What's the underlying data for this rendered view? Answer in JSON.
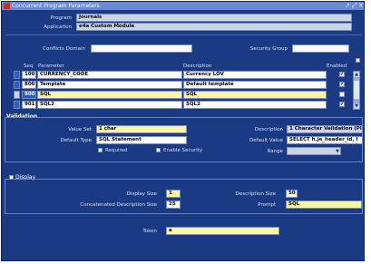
{
  "window": {
    "title": "Concurrent Program Parameters",
    "controls": [
      "↗",
      "⤢",
      "✕"
    ]
  },
  "header": {
    "program_label": "Program",
    "program_value": "Journals",
    "application_label": "Application",
    "application_value": "e4a Custom Module",
    "conflicts_label": "Conflicts Domain",
    "conflicts_value": "",
    "security_label": "Security Group",
    "security_value": ""
  },
  "grid": {
    "headers": {
      "seq": "Seq",
      "parameter": "Parameter",
      "description": "Description",
      "enabled": "Enabled"
    },
    "rows": [
      {
        "seq": "100",
        "parameter": "CURRENCY_CODE",
        "description": "Currency LOV",
        "enabled": "✔"
      },
      {
        "seq": "800",
        "parameter": "Template",
        "description": "Default template",
        "enabled": "✔"
      },
      {
        "seq": "900",
        "parameter": "SQL",
        "description": "SQL",
        "enabled": ""
      },
      {
        "seq": "901",
        "parameter": "SQL2",
        "description": "SQL2",
        "enabled": "✔"
      }
    ]
  },
  "validation": {
    "title": "Validation",
    "value_set_label": "Value Set",
    "value_set": "1 char",
    "description_label": "Description",
    "description": "1 Character Validation (Pla",
    "default_type_label": "Default Type",
    "default_type": "SQL Statement",
    "default_value_label": "Default Value",
    "default_value": "SELECT h.je_header_id, I",
    "required_label": "Required",
    "enable_security_label": "Enable Security",
    "range_label": "Range",
    "range_value": ""
  },
  "display": {
    "title": "Display",
    "display_size_label": "Display Size",
    "display_size": "1",
    "desc_size_label": "Description Size",
    "desc_size": "50",
    "concat_label": "Concatenated Description Size",
    "concat_size": "25",
    "prompt_label": "Prompt",
    "prompt": "SQL",
    "token_label": "Token",
    "token": "a"
  }
}
